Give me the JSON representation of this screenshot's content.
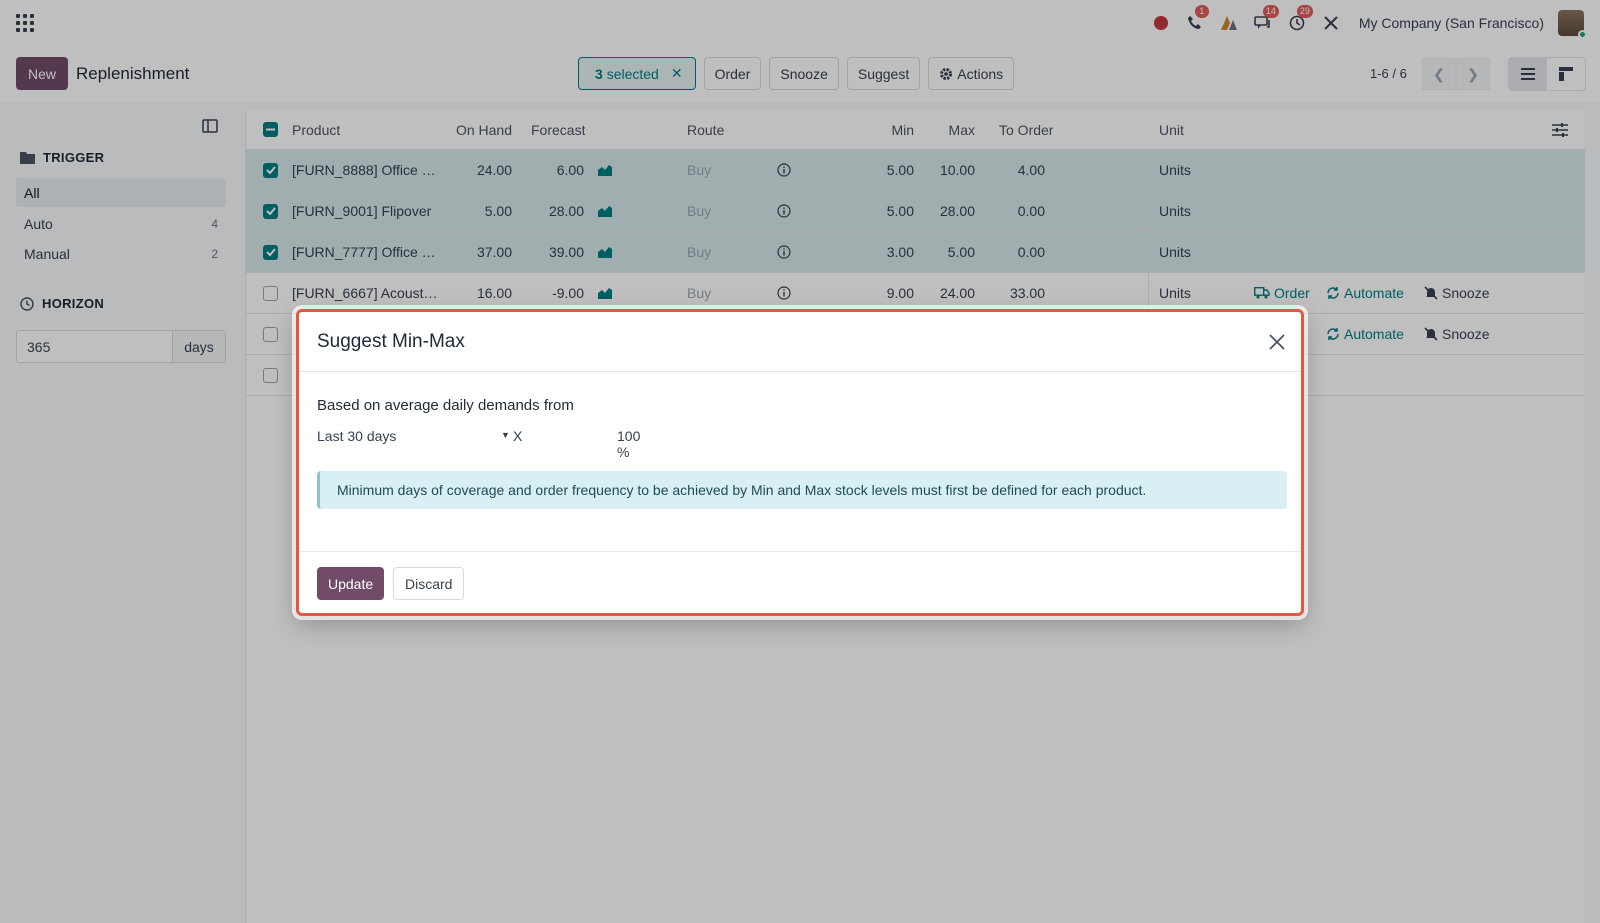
{
  "nav": {
    "company": "My Company (San Francisco)",
    "badges": {
      "phone": "1",
      "messages": "14",
      "activities": "29"
    }
  },
  "control": {
    "new_label": "New",
    "title": "Replenishment",
    "selected_count": "3",
    "selected_label": "selected",
    "order_label": "Order",
    "snooze_label": "Snooze",
    "suggest_label": "Suggest",
    "actions_label": "Actions",
    "pager": "1-6 / 6"
  },
  "sidebar": {
    "trigger_title": "TRIGGER",
    "items": [
      {
        "label": "All",
        "count": ""
      },
      {
        "label": "Auto",
        "count": "4"
      },
      {
        "label": "Manual",
        "count": "2"
      }
    ],
    "horizon_title": "HORIZON",
    "horizon_value": "365",
    "horizon_unit": "days"
  },
  "table": {
    "headers": {
      "product": "Product",
      "on_hand": "On Hand",
      "forecast": "Forecast",
      "route": "Route",
      "min": "Min",
      "max": "Max",
      "to_order": "To Order",
      "unit": "Unit"
    },
    "rows": [
      {
        "product": "[FURN_8888] Office …",
        "on_hand": "24.00",
        "forecast": "6.00",
        "route": "Buy",
        "min": "5.00",
        "max": "10.00",
        "to_order": "4.00",
        "unit": "Units",
        "selected": true
      },
      {
        "product": "[FURN_9001] Flipover",
        "on_hand": "5.00",
        "forecast": "28.00",
        "route": "Buy",
        "min": "5.00",
        "max": "28.00",
        "to_order": "0.00",
        "unit": "Units",
        "selected": true
      },
      {
        "product": "[FURN_7777] Office …",
        "on_hand": "37.00",
        "forecast": "39.00",
        "route": "Buy",
        "min": "3.00",
        "max": "5.00",
        "to_order": "0.00",
        "unit": "Units",
        "selected": true
      },
      {
        "product": "[FURN_6667] Acoust…",
        "on_hand": "16.00",
        "forecast": "-9.00",
        "route": "Buy",
        "min": "9.00",
        "max": "24.00",
        "to_order": "33.00",
        "unit": "Units",
        "selected": false
      }
    ],
    "row_actions": {
      "order": "Order",
      "automate": "Automate",
      "snooze": "Snooze"
    }
  },
  "modal": {
    "title": "Suggest Min-Max",
    "label": "Based on average daily demands from",
    "period": "Last 30 days",
    "multiplier": "X",
    "percent": "100 %",
    "info": "Minimum days of coverage and order frequency to be achieved by Min and Max stock levels must first be defined for each product.",
    "update_label": "Update",
    "discard_label": "Discard"
  }
}
